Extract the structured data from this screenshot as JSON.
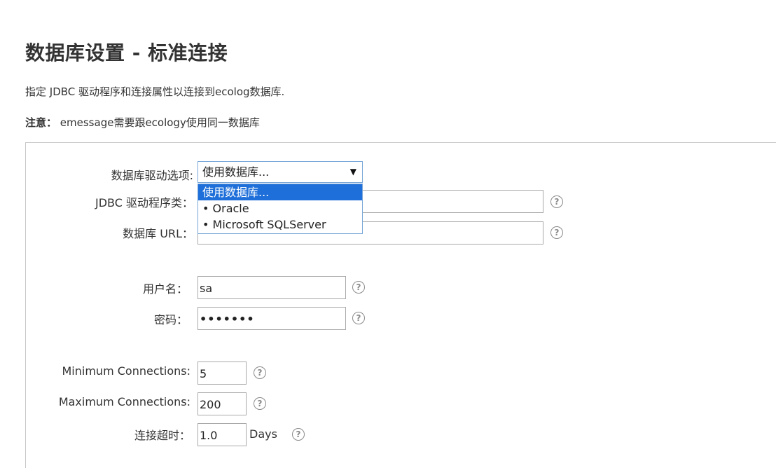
{
  "page": {
    "title": "数据库设置 - 标准连接",
    "subtitle": "指定 JDBC 驱动程序和连接属性以连接到ecolog数据库.",
    "note_label": "注意：",
    "note_text": "emessage需要跟ecology使用同一数据库"
  },
  "form": {
    "driver_select": {
      "label": "数据库驱动选项:",
      "selected": "使用数据库...",
      "arrow": "▼",
      "options": [
        "使用数据库...",
        "• Oracle",
        "• Microsoft SQLServer"
      ]
    },
    "jdbc_driver_class": {
      "label": "JDBC 驱动程序类：",
      "value": ""
    },
    "db_url": {
      "label": "数据库 URL：",
      "value": ""
    },
    "username": {
      "label": "用户名：",
      "value": "sa"
    },
    "password": {
      "label": "密码：",
      "value": "•••••••"
    },
    "min_connections": {
      "label": "Minimum Connections:",
      "value": "5"
    },
    "max_connections": {
      "label": "Maximum Connections:",
      "value": "200"
    },
    "timeout": {
      "label": "连接超时：",
      "value": "1.0",
      "unit": "Days"
    },
    "help_glyph": "?"
  }
}
